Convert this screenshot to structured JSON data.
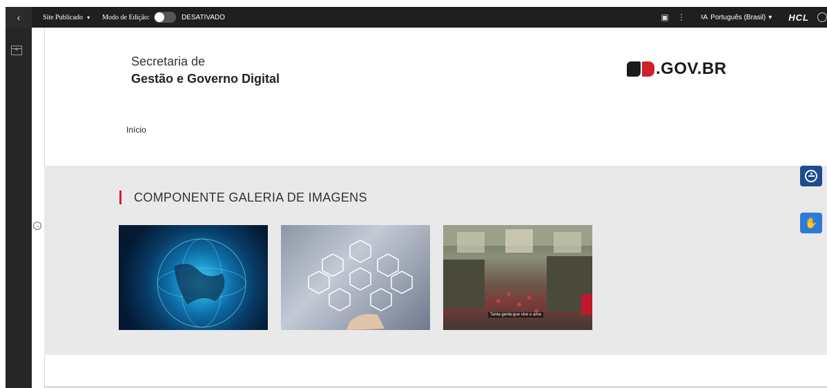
{
  "toolbar": {
    "back_icon": "chevron-left-icon",
    "site_label": "Site Publicado",
    "site_caret": "▾",
    "mode_label": "Modo de Edição:",
    "mode_status": "DESATIVADO",
    "panel_icon": "panel-icon",
    "more_icon": "more-vertical-icon",
    "language_icon_text": "ᵡA",
    "language_label": "Português (Brasil)",
    "language_caret": "▾",
    "brand": "HCL"
  },
  "header": {
    "secretaria_line1": "Secretaria de",
    "secretaria_line2": "Gestão e Governo Digital",
    "logo_text": ".GOV.BR"
  },
  "nav": {
    "breadcrumb": "Início"
  },
  "gallery": {
    "title": "COMPONENTE GALERIA DE IMAGENS",
    "images": [
      {
        "name": "globe-image"
      },
      {
        "name": "business-icons-image"
      },
      {
        "name": "market-image",
        "caption": "Tanta gente que vive e ama"
      }
    ]
  },
  "colors": {
    "accent_red": "#d0202a",
    "toolbar_bg": "#1f1f1f",
    "band_bg": "#e9e9e9",
    "accessibility_blue": "#1e4c8f",
    "libras_blue": "#2d7bd9"
  }
}
